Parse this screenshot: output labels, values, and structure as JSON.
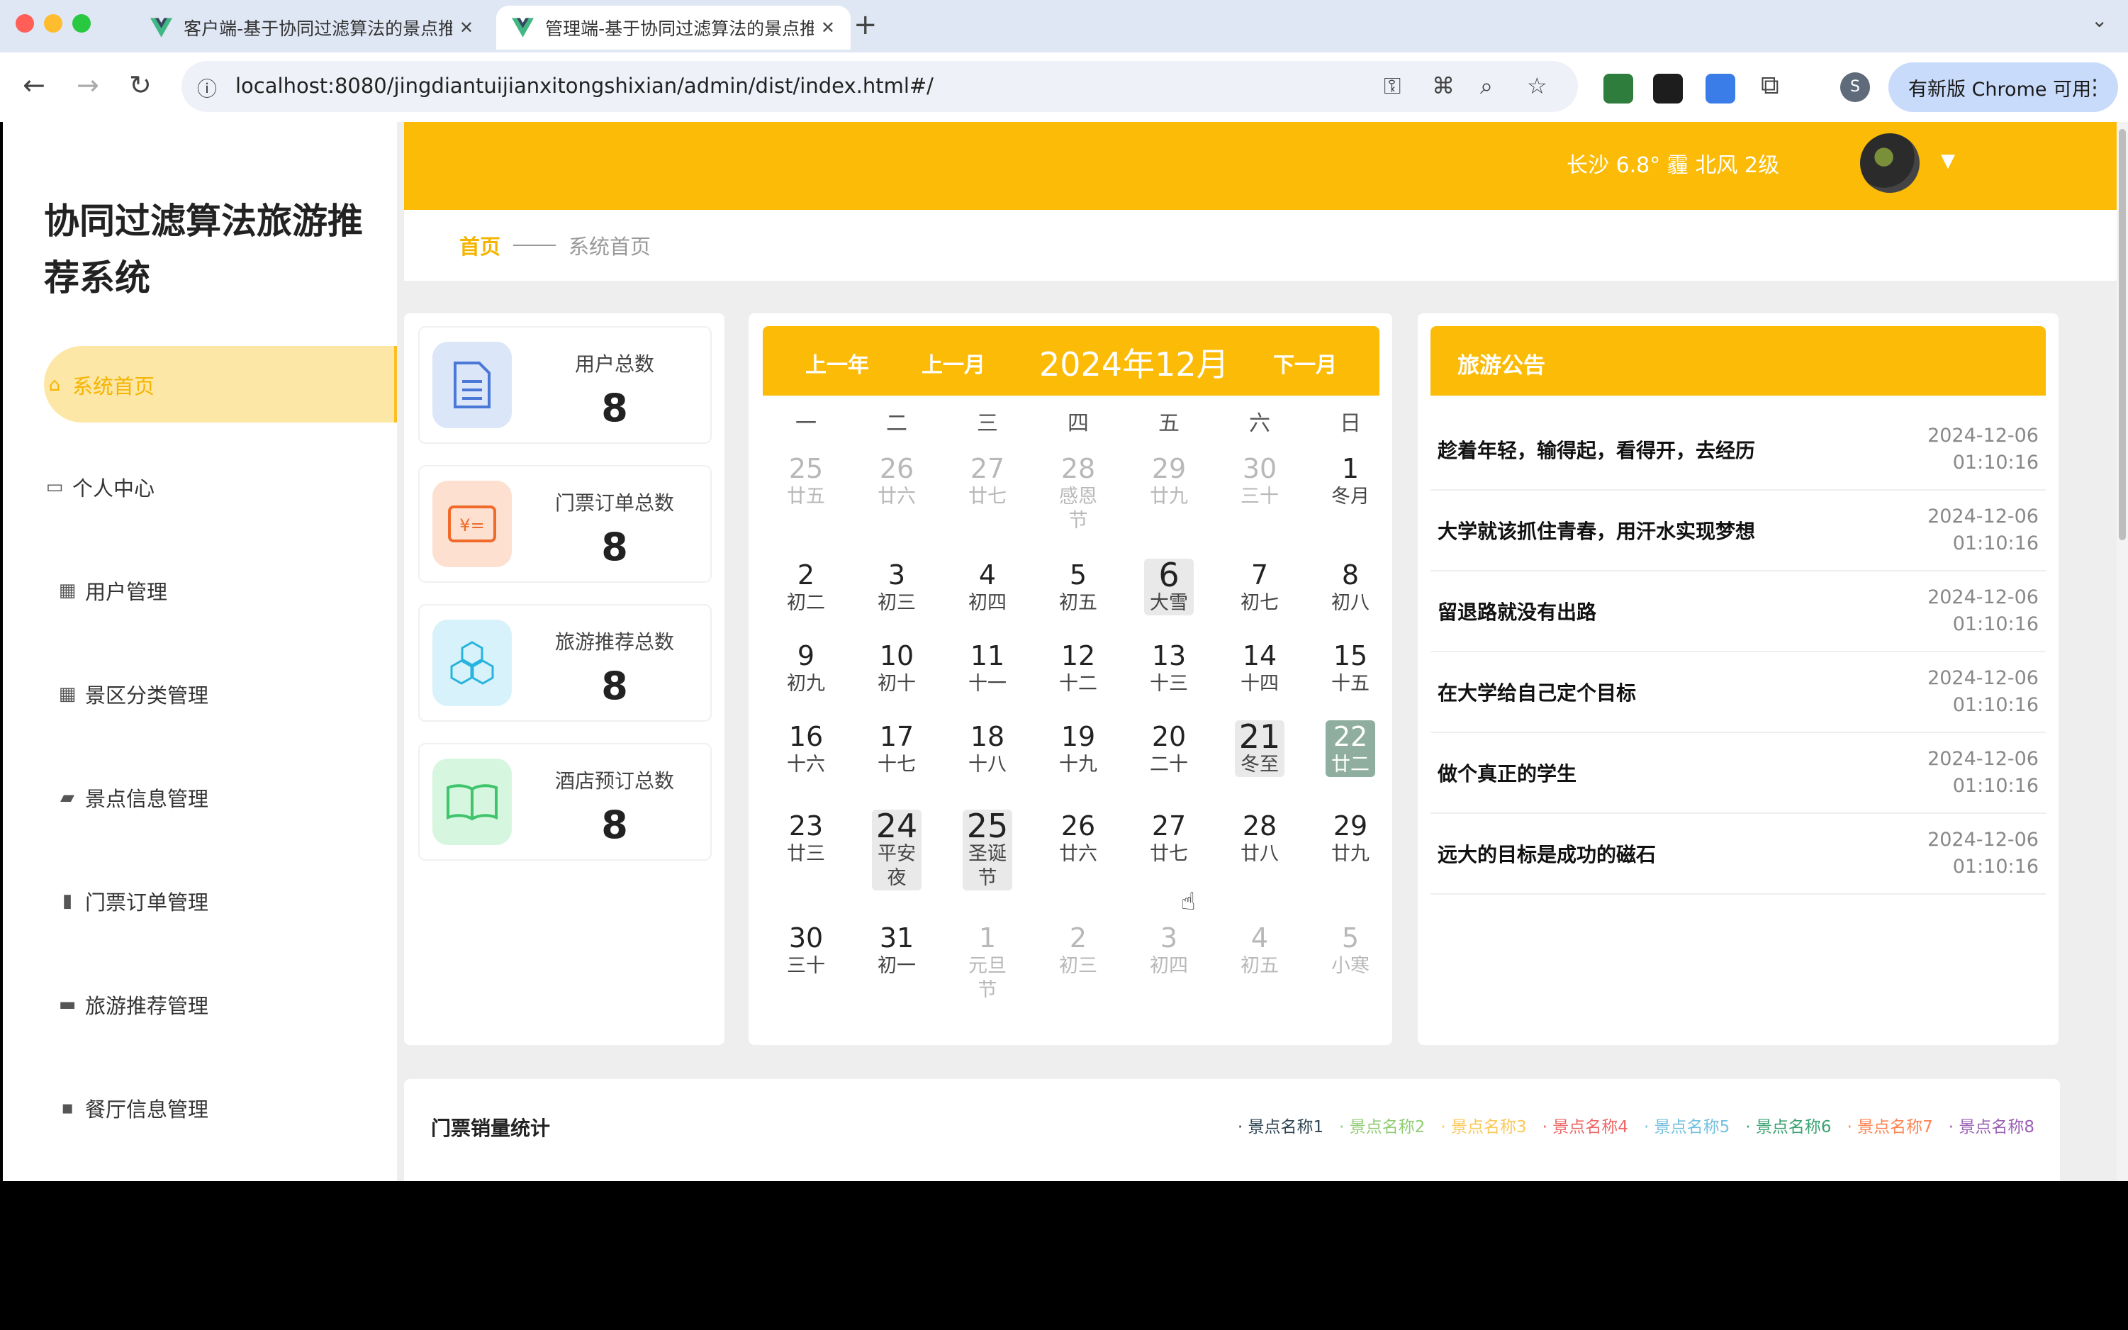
{
  "browser": {
    "tabs": [
      {
        "title": "客户端-基于协同过滤算法的景点推荐系统",
        "icon": "vue-icon"
      },
      {
        "title": "管理端-基于协同过滤算法的景点推荐系统",
        "icon": "vue-icon"
      }
    ],
    "new_tab": "+",
    "url": "localhost:8080/jingdiantuijianxitongshixian/admin/dist/index.html#/",
    "update_label": "有新版 Chrome 可用",
    "profile_initial": "S"
  },
  "sidebar": {
    "title": "协同过滤算法旅游推荐系统",
    "items": [
      {
        "label": "系统首页",
        "icon": "home-icon"
      },
      {
        "label": "个人中心",
        "icon": "card-icon"
      },
      {
        "label": "用户管理",
        "icon": "grid-icon"
      },
      {
        "label": "景区分类管理",
        "icon": "grid-icon"
      },
      {
        "label": "景点信息管理",
        "icon": "wallet-icon"
      },
      {
        "label": "门票订单管理",
        "icon": "bar-chart-icon"
      },
      {
        "label": "旅游推荐管理",
        "icon": "briefcase-icon"
      },
      {
        "label": "餐厅信息管理",
        "icon": "message-icon"
      }
    ]
  },
  "header": {
    "weather": "长沙  6.8°  霾  北风  2级"
  },
  "breadcrumb": {
    "home": "首页",
    "current": "系统首页"
  },
  "stats": [
    {
      "label": "用户总数",
      "value": "8",
      "icon": "document-icon",
      "color": "#4a78d6"
    },
    {
      "label": "门票订单总数",
      "value": "8",
      "icon": "ticket-icon",
      "color": "#f06a2a"
    },
    {
      "label": "旅游推荐总数",
      "value": "8",
      "icon": "cubes-icon",
      "color": "#27b4de"
    },
    {
      "label": "酒店预订总数",
      "value": "8",
      "icon": "book-icon",
      "color": "#3ec46a"
    }
  ],
  "calendar": {
    "prev_year": "上一年",
    "prev_month": "上一月",
    "title": "2024年12月",
    "next_month": "下一月",
    "weekdays": [
      "一",
      "二",
      "三",
      "四",
      "五",
      "六",
      "日"
    ],
    "weeks": [
      [
        {
          "d": "25",
          "l": "廿五",
          "o": true
        },
        {
          "d": "26",
          "l": "廿六",
          "o": true
        },
        {
          "d": "27",
          "l": "廿七",
          "o": true
        },
        {
          "d": "28",
          "l": "感恩节",
          "o": true
        },
        {
          "d": "29",
          "l": "廿九",
          "o": true
        },
        {
          "d": "30",
          "l": "三十",
          "o": true
        },
        {
          "d": "1",
          "l": "冬月"
        }
      ],
      [
        {
          "d": "2",
          "l": "初二"
        },
        {
          "d": "3",
          "l": "初三"
        },
        {
          "d": "4",
          "l": "初四"
        },
        {
          "d": "5",
          "l": "初五"
        },
        {
          "d": "6",
          "l": "大雪",
          "h": true
        },
        {
          "d": "7",
          "l": "初七"
        },
        {
          "d": "8",
          "l": "初八"
        }
      ],
      [
        {
          "d": "9",
          "l": "初九"
        },
        {
          "d": "10",
          "l": "初十"
        },
        {
          "d": "11",
          "l": "十一"
        },
        {
          "d": "12",
          "l": "十二"
        },
        {
          "d": "13",
          "l": "十三"
        },
        {
          "d": "14",
          "l": "十四"
        },
        {
          "d": "15",
          "l": "十五"
        }
      ],
      [
        {
          "d": "16",
          "l": "十六"
        },
        {
          "d": "17",
          "l": "十七"
        },
        {
          "d": "18",
          "l": "十八"
        },
        {
          "d": "19",
          "l": "十九"
        },
        {
          "d": "20",
          "l": "二十"
        },
        {
          "d": "21",
          "l": "冬至",
          "h": true
        },
        {
          "d": "22",
          "l": "廿二",
          "t": true
        }
      ],
      [
        {
          "d": "23",
          "l": "廿三"
        },
        {
          "d": "24",
          "l": "平安夜",
          "h": true
        },
        {
          "d": "25",
          "l": "圣诞节",
          "h": true
        },
        {
          "d": "26",
          "l": "廿六"
        },
        {
          "d": "27",
          "l": "廿七"
        },
        {
          "d": "28",
          "l": "廿八"
        },
        {
          "d": "29",
          "l": "廿九"
        }
      ],
      [
        {
          "d": "30",
          "l": "三十"
        },
        {
          "d": "31",
          "l": "初一"
        },
        {
          "d": "1",
          "l": "元旦节",
          "o": true
        },
        {
          "d": "2",
          "l": "初三",
          "o": true
        },
        {
          "d": "3",
          "l": "初四",
          "o": true
        },
        {
          "d": "4",
          "l": "初五",
          "o": true
        },
        {
          "d": "5",
          "l": "小寒",
          "o": true
        }
      ]
    ]
  },
  "notices": {
    "title": "旅游公告",
    "items": [
      {
        "text": "趁着年轻，输得起，看得开，去经历",
        "date": "2024-12-06",
        "time": "01:10:16"
      },
      {
        "text": "大学就该抓住青春，用汗水实现梦想",
        "date": "2024-12-06",
        "time": "01:10:16"
      },
      {
        "text": "留退路就没有出路",
        "date": "2024-12-06",
        "time": "01:10:16"
      },
      {
        "text": "在大学给自己定个目标",
        "date": "2024-12-06",
        "time": "01:10:16"
      },
      {
        "text": "做个真正的学生",
        "date": "2024-12-06",
        "time": "01:10:16"
      },
      {
        "text": "远大的目标是成功的磁石",
        "date": "2024-12-06",
        "time": "01:10:16"
      }
    ]
  },
  "sales_chart": {
    "title": "门票销量统计",
    "legend": [
      {
        "name": "景点名称1",
        "color": "#2f4554"
      },
      {
        "name": "景点名称2",
        "color": "#91cc75"
      },
      {
        "name": "景点名称3",
        "color": "#fac858"
      },
      {
        "name": "景点名称4",
        "color": "#ee6666"
      },
      {
        "name": "景点名称5",
        "color": "#73c0de"
      },
      {
        "name": "景点名称6",
        "color": "#3ba272"
      },
      {
        "name": "景点名称7",
        "color": "#fc8452"
      },
      {
        "name": "景点名称8",
        "color": "#9a60b4"
      }
    ]
  },
  "colors": {
    "accent": "#fcbb06",
    "active_menu_bg": "#fde7a6",
    "today": "#8fae9f"
  }
}
